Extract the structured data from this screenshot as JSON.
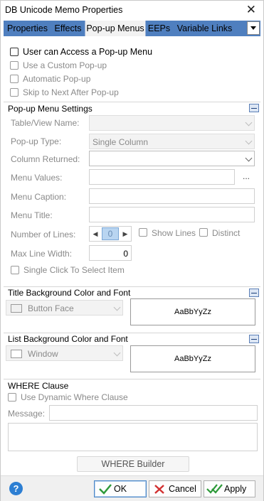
{
  "window": {
    "title": "DB Unicode Memo Properties",
    "close_icon": "close-icon"
  },
  "tabs": [
    {
      "label": "Properties"
    },
    {
      "label": "Effects"
    },
    {
      "label": "Pop-up Menus",
      "active": true
    },
    {
      "label": "EEPs"
    },
    {
      "label": "Variable Links"
    }
  ],
  "options": {
    "user_access": "User can Access a Pop-up Menu",
    "custom_popup": "Use a Custom Pop-up",
    "automatic_popup": "Automatic Pop-up",
    "skip_next": "Skip to Next After Pop-up"
  },
  "popup_settings": {
    "header": "Pop-up Menu Settings",
    "table_view_label": "Table/View Name:",
    "table_view_value": "",
    "popup_type_label": "Pop-up Type:",
    "popup_type_value": "Single Column",
    "column_returned_label": "Column Returned:",
    "column_returned_value": "",
    "menu_values_label": "Menu Values:",
    "menu_values_value": "",
    "menu_values_button": "...",
    "menu_caption_label": "Menu Caption:",
    "menu_caption_value": "",
    "menu_title_label": "Menu Title:",
    "menu_title_value": "",
    "number_lines_label": "Number of Lines:",
    "number_lines_value": "0",
    "show_lines_label": "Show Lines",
    "distinct_label": "Distinct",
    "max_line_width_label": "Max Line Width:",
    "max_line_width_value": "0",
    "single_click_label": "Single Click To Select Item"
  },
  "title_bg": {
    "header": "Title Background Color and Font",
    "color_value": "Button Face",
    "font_sample": "AaBbYyZz"
  },
  "list_bg": {
    "header": "List Background Color and Font",
    "color_value": "Window",
    "font_sample": "AaBbYyZz"
  },
  "where": {
    "header": "WHERE Clause",
    "dynamic_label": "Use Dynamic Where Clause",
    "message_label": "Message:",
    "message_value": "",
    "builder_button": "WHERE Builder"
  },
  "footer": {
    "help_icon": "?",
    "ok_label": "OK",
    "cancel_label": "Cancel",
    "apply_label": "Apply"
  },
  "colors": {
    "tab_bar": "#4f7fbf",
    "ok_check": "#2e9a3a",
    "cancel_x": "#d23030",
    "help": "#2d7fd3"
  }
}
